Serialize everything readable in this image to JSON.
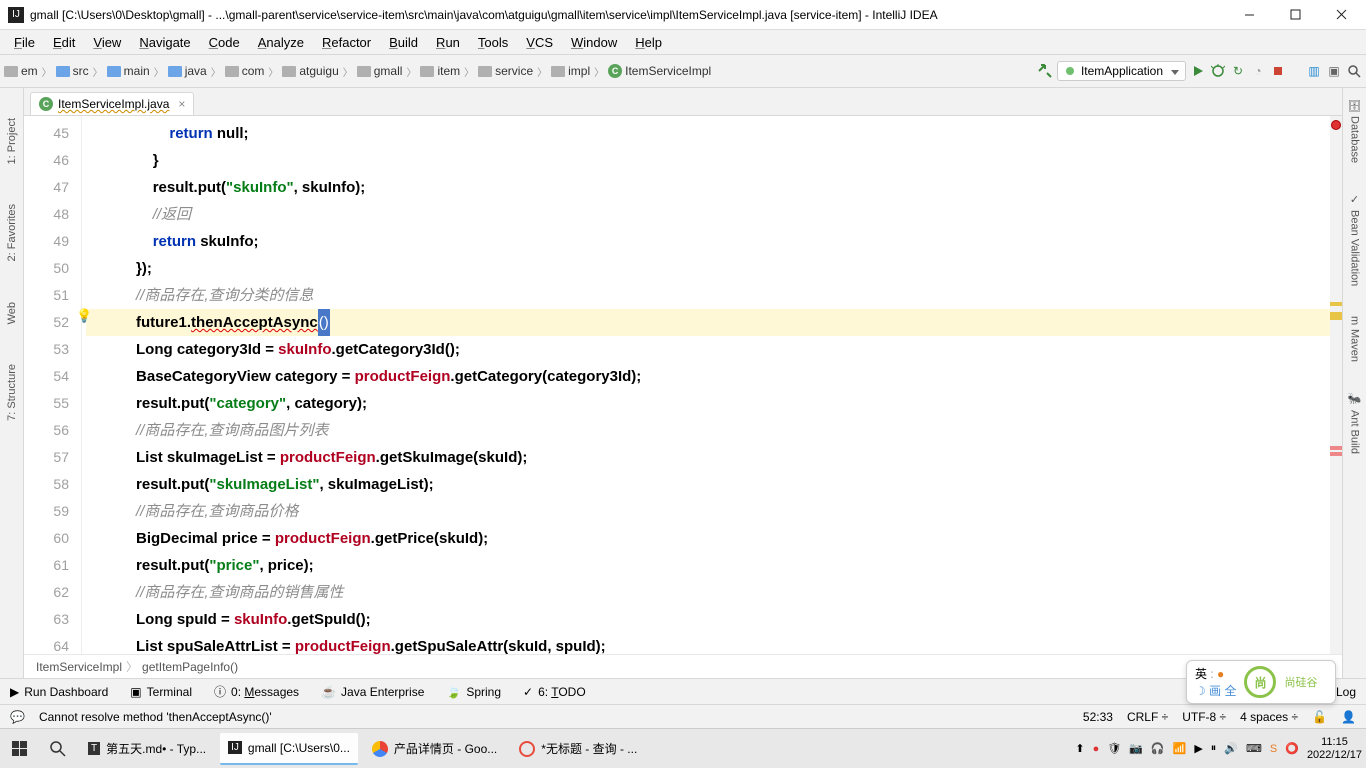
{
  "title": "gmall [C:\\Users\\0\\Desktop\\gmall] - ...\\gmall-parent\\service\\service-item\\src\\main\\java\\com\\atguigu\\gmall\\item\\service\\impl\\ItemServiceImpl.java [service-item] - IntelliJ IDEA",
  "menus": [
    "File",
    "Edit",
    "View",
    "Navigate",
    "Code",
    "Analyze",
    "Refactor",
    "Build",
    "Run",
    "Tools",
    "VCS",
    "Window",
    "Help"
  ],
  "breadcrumbs": [
    "em",
    "src",
    "main",
    "java",
    "com",
    "atguigu",
    "gmall",
    "item",
    "service",
    "impl",
    "ItemServiceImpl"
  ],
  "run_config": "ItemApplication",
  "tab": {
    "label": "ItemServiceImpl.java"
  },
  "lines_start": 45,
  "lines_end": 64,
  "code": {
    "l45": {
      "indent": "                    ",
      "kw": "return",
      "rest": " null;"
    },
    "l46": {
      "indent": "                ",
      "b": "}"
    },
    "l47": {
      "indent": "                ",
      "a": "result.",
      "m": "put",
      "p": "(",
      "s": "\"skuInfo\"",
      "r": ", skuInfo);"
    },
    "l48": {
      "indent": "                ",
      "c": "//返回"
    },
    "l49": {
      "indent": "                ",
      "kw": "return",
      "rest": " skuInfo;"
    },
    "l50": {
      "indent": "            ",
      "b": "});"
    },
    "l51": {
      "indent": "            ",
      "c": "//商品存在,查询分类的信息"
    },
    "l52": {
      "indent": "            ",
      "a": "future1.",
      "m": "thenAcceptAsync",
      "sel": "()"
    },
    "l53": {
      "indent": "            ",
      "t": "Long category3Id = ",
      "err": "skuInfo",
      "r": ".getCategory3Id();"
    },
    "l54": {
      "indent": "            ",
      "t": "BaseCategoryView category = ",
      "fn": "productFeign",
      "r": ".getCategory(category3Id);"
    },
    "l55": {
      "indent": "            ",
      "a": "result.",
      "m": "put",
      "p": "(",
      "s": "\"category\"",
      "r": ", category);"
    },
    "l56": {
      "indent": "            ",
      "c": "//商品存在,查询商品图片列表"
    },
    "l57": {
      "indent": "            ",
      "t": "List<SkuImage> skuImageList = ",
      "fn": "productFeign",
      "r": ".getSkuImage(skuId);"
    },
    "l58": {
      "indent": "            ",
      "a": "result.",
      "m": "put",
      "p": "(",
      "s": "\"skuImageList\"",
      "r": ", skuImageList);"
    },
    "l59": {
      "indent": "            ",
      "c": "//商品存在,查询商品价格"
    },
    "l60": {
      "indent": "            ",
      "t": "BigDecimal price = ",
      "fn": "productFeign",
      "r": ".getPrice(skuId);"
    },
    "l61": {
      "indent": "            ",
      "a": "result.",
      "m": "put",
      "p": "(",
      "s": "\"price\"",
      "r": ", price);"
    },
    "l62": {
      "indent": "            ",
      "c": "//商品存在,查询商品的销售属性"
    },
    "l63": {
      "indent": "            ",
      "t": "Long spuId = ",
      "err": "skuInfo",
      "r": ".getSpuId();"
    },
    "l64": {
      "indent": "            ",
      "t": "List<SpuSaleAttr> spuSaleAttrList = ",
      "fn": "productFeign",
      "r": ".getSpuSaleAttr(skuId, spuId);"
    }
  },
  "nav_trail": [
    "ItemServiceImpl",
    "getItemPageInfo()"
  ],
  "tool_windows": [
    "Run Dashboard",
    "Terminal",
    "0: Messages",
    "Java Enterprise",
    "Spring",
    "6: TODO"
  ],
  "event_log": "Event Log",
  "status": {
    "msg": "Cannot resolve method 'thenAcceptAsync()'",
    "pos": "52:33",
    "le": "CRLF",
    "enc": "UTF-8",
    "indent": "4 spaces"
  },
  "left_tools": [
    "1: Project",
    "2: Favorites",
    "Web",
    "7: Structure"
  ],
  "right_tools": [
    "Database",
    "Bean Validation",
    "Maven",
    "Ant Build"
  ],
  "taskbar": {
    "items": [
      "第五天.md• - Typ...",
      "gmall [C:\\Users\\0...",
      "产品详情页 - Goo...",
      "*无标题 - 查询 - ..."
    ],
    "time": "11:15",
    "date": "2022/12/17"
  },
  "ime": {
    "a": "英",
    "b": "画 全",
    "c": "尚硅谷"
  }
}
